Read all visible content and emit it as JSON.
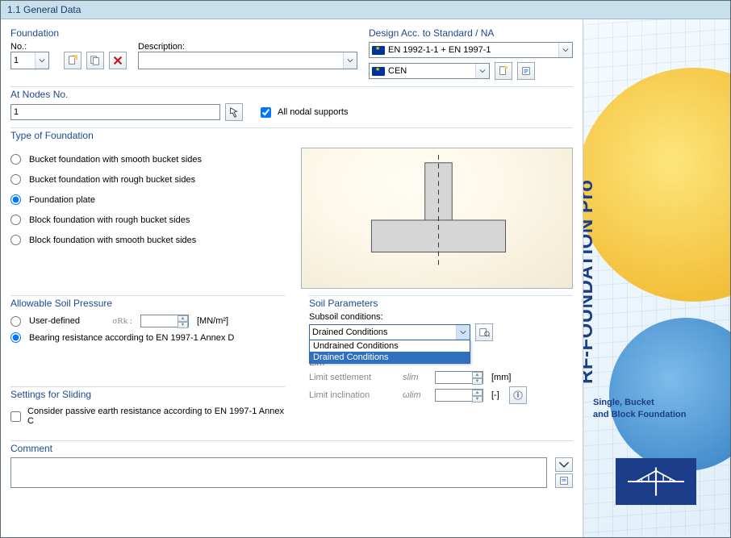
{
  "title": "1.1 General Data",
  "foundation": {
    "title": "Foundation",
    "no_label": "No.:",
    "no_value": "1",
    "desc_label": "Description:",
    "desc_value": ""
  },
  "design": {
    "title": "Design Acc. to Standard / NA",
    "standard": "EN 1992-1-1 + EN 1997-1",
    "na": "CEN"
  },
  "nodes": {
    "title": "At Nodes No.",
    "value": "1",
    "all_label": "All nodal supports",
    "all_checked": true
  },
  "type": {
    "title": "Type of Foundation",
    "options": [
      "Bucket foundation with smooth bucket sides",
      "Bucket foundation with rough bucket sides",
      "Foundation plate",
      "Block foundation with rough bucket sides",
      "Block foundation with smooth bucket sides"
    ],
    "selected": 2
  },
  "allowable": {
    "title": "Allowable Soil Pressure",
    "user_label": "User-defined",
    "sigma_label": "σRk :",
    "sigma_value": "",
    "sigma_unit": "[MN/m²]",
    "bearing_label": "Bearing resistance according to EN 1997-1 Annex D",
    "selected": "bearing"
  },
  "soil": {
    "title": "Soil Parameters",
    "subsoil_label": "Subsoil conditions:",
    "subsoil_value": "Drained Conditions",
    "options": [
      "Undrained Conditions",
      "Drained Conditions"
    ],
    "highlight_index": 1
  },
  "limits": {
    "title": "Lim",
    "settlement_label": "Limit settlement",
    "settlement_sym": "slim",
    "settlement_unit": "[mm]",
    "inclination_label": "Limit inclination",
    "inclination_sym": "ωlim",
    "inclination_unit": "[-]"
  },
  "sliding": {
    "title": "Settings for Sliding",
    "label": "Consider passive earth resistance according to EN 1997-1 Annex C",
    "checked": false
  },
  "comment": {
    "title": "Comment",
    "value": ""
  },
  "sidebar": {
    "product": "RF-FOUNDATION Pro",
    "tagline1": "Single, Bucket",
    "tagline2": "and Block Foundation"
  }
}
